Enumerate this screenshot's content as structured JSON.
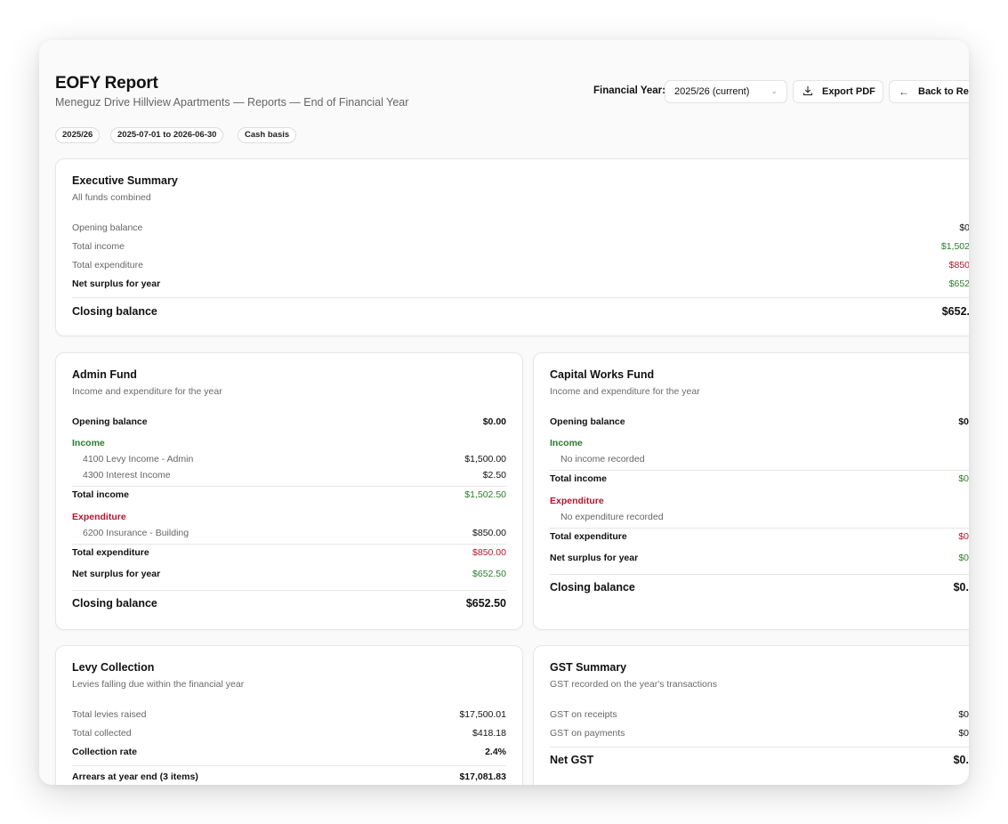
{
  "header": {
    "title": "EOFY Report",
    "subtitle": "Meneguz Drive Hillview Apartments — Reports — End of Financial Year",
    "pills": [
      "2025/26",
      "2025-07-01 to 2026-06-30",
      "Cash basis"
    ],
    "fy_label": "Financial Year:",
    "fy_value": "2025/26 (current)",
    "export_label": "Export PDF",
    "back_label": "Back to Rep"
  },
  "colors": {
    "positive": "#2b7a2b",
    "negative": "#b3162b"
  },
  "icons": {
    "export": "download-icon",
    "back": "arrow-left-icon",
    "select": "chevron-down-icon"
  },
  "executive": {
    "title": "Executive Summary",
    "subtitle": "All funds combined",
    "opening_label": "Opening balance",
    "opening_value": "$0",
    "income_label": "Total income",
    "income_value": "$1,502",
    "expenditure_label": "Total expenditure",
    "expenditure_value": "$850",
    "net_label": "Net surplus for year",
    "net_value": "$652",
    "closing_label": "Closing balance",
    "closing_value": "$652."
  },
  "admin": {
    "title": "Admin Fund",
    "subtitle": "Income and expenditure for the year",
    "opening_label": "Opening balance",
    "opening_value": "$0.00",
    "income_heading": "Income",
    "income_items": [
      {
        "label": "4100 Levy Income - Admin",
        "value": "$1,500.00"
      },
      {
        "label": "4300 Interest Income",
        "value": "$2.50"
      }
    ],
    "total_income_label": "Total income",
    "total_income_value": "$1,502.50",
    "expenditure_heading": "Expenditure",
    "expenditure_items": [
      {
        "label": "6200 Insurance - Building",
        "value": "$850.00"
      }
    ],
    "total_expenditure_label": "Total expenditure",
    "total_expenditure_value": "$850.00",
    "net_label": "Net surplus for year",
    "net_value": "$652.50",
    "closing_label": "Closing balance",
    "closing_value": "$652.50"
  },
  "capital": {
    "title": "Capital Works Fund",
    "subtitle": "Income and expenditure for the year",
    "opening_label": "Opening balance",
    "opening_value": "$0",
    "income_heading": "Income",
    "no_income": "No income recorded",
    "total_income_label": "Total income",
    "total_income_value": "$0",
    "expenditure_heading": "Expenditure",
    "no_expenditure": "No expenditure recorded",
    "total_expenditure_label": "Total expenditure",
    "total_expenditure_value": "$0",
    "net_label": "Net surplus for year",
    "net_value": "$0",
    "closing_label": "Closing balance",
    "closing_value": "$0."
  },
  "levy": {
    "title": "Levy Collection",
    "subtitle": "Levies falling due within the financial year",
    "raised_label": "Total levies raised",
    "raised_value": "$17,500.01",
    "collected_label": "Total collected",
    "collected_value": "$418.18",
    "rate_label": "Collection rate",
    "rate_value": "2.4%",
    "arrears_label": "Arrears at year end (3 items)",
    "arrears_value": "$17,081.83"
  },
  "gst": {
    "title": "GST Summary",
    "subtitle": "GST recorded on the year's transactions",
    "receipts_label": "GST on receipts",
    "receipts_value": "$0",
    "payments_label": "GST on payments",
    "payments_value": "$0",
    "net_label": "Net GST",
    "net_value": "$0."
  }
}
